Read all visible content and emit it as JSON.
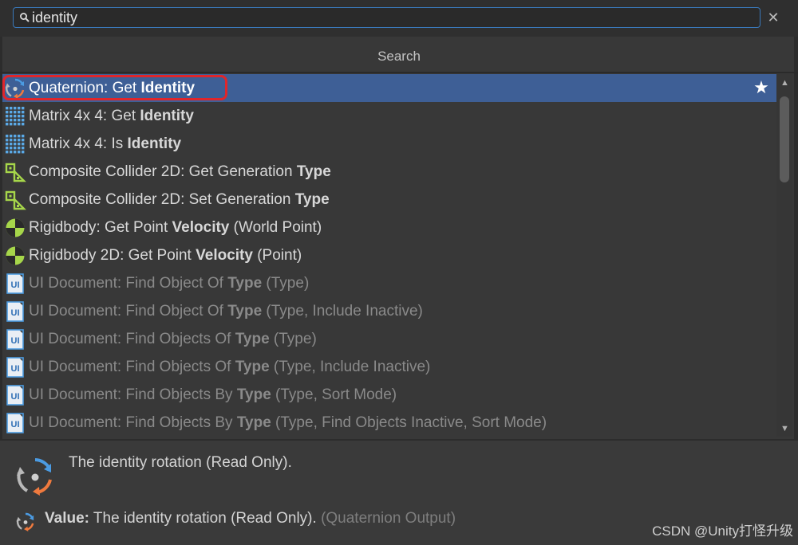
{
  "search": {
    "value": "identity",
    "clear_symbol": "✕"
  },
  "section_header": "Search",
  "rows": [
    {
      "icon": "quaternion-icon",
      "pre": "Quaternion: Get ",
      "bold": "Identity",
      "post": "",
      "state": "selected"
    },
    {
      "icon": "matrix-icon",
      "pre": "Matrix 4x 4: Get ",
      "bold": "Identity",
      "post": "",
      "state": "normal"
    },
    {
      "icon": "matrix-icon",
      "pre": "Matrix 4x 4: Is ",
      "bold": "Identity",
      "post": "",
      "state": "normal"
    },
    {
      "icon": "composite-collider-icon",
      "pre": "Composite Collider 2D: Get Generation ",
      "bold": "Type",
      "post": "",
      "state": "normal"
    },
    {
      "icon": "composite-collider-icon",
      "pre": "Composite Collider 2D: Set Generation ",
      "bold": "Type",
      "post": "",
      "state": "normal"
    },
    {
      "icon": "rigidbody-icon",
      "pre": "Rigidbody: Get Point ",
      "bold": "Velocity",
      "post": " (World Point)",
      "state": "normal"
    },
    {
      "icon": "rigidbody-icon",
      "pre": "Rigidbody 2D: Get Point ",
      "bold": "Velocity",
      "post": " (Point)",
      "state": "normal"
    },
    {
      "icon": "ui-document-icon",
      "pre": "UI Document: Find Object Of ",
      "bold": "Type",
      "post": " (Type)",
      "state": "disabled"
    },
    {
      "icon": "ui-document-icon",
      "pre": "UI Document: Find Object Of ",
      "bold": "Type",
      "post": " (Type, Include Inactive)",
      "state": "disabled"
    },
    {
      "icon": "ui-document-icon",
      "pre": "UI Document: Find Objects Of ",
      "bold": "Type",
      "post": " (Type)",
      "state": "disabled"
    },
    {
      "icon": "ui-document-icon",
      "pre": "UI Document: Find Objects Of ",
      "bold": "Type",
      "post": " (Type, Include Inactive)",
      "state": "disabled"
    },
    {
      "icon": "ui-document-icon",
      "pre": "UI Document: Find Objects By ",
      "bold": "Type",
      "post": " (Type, Sort Mode)",
      "state": "disabled"
    },
    {
      "icon": "ui-document-icon",
      "pre": "UI Document: Find Objects By ",
      "bold": "Type",
      "post": " (Type, Find Objects Inactive, Sort Mode)",
      "state": "disabled"
    }
  ],
  "ui_icon_text": "UI",
  "favorite_symbol": "★",
  "details": {
    "description": "The identity rotation (Read Only).",
    "value_label": "Value:",
    "value_text": " The identity rotation (Read Only). ",
    "value_output": "(Quaternion Output)"
  },
  "watermark": "CSDN @Unity打怪升级",
  "colors": {
    "selection": "#3e5f96",
    "highlight_outline": "#e0262b",
    "search_border": "#3a79bb",
    "rigidbody_green": "#a6d64a",
    "matrix_blue": "#5aa9e6",
    "ui_doc_blue": "#4d9be0"
  }
}
